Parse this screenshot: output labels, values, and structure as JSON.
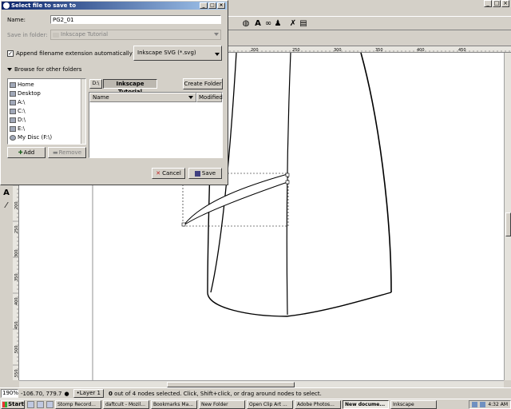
{
  "dialog": {
    "title": "Select file to save to",
    "name_label": "Name:",
    "name_value": "PG2_01",
    "save_in_label": "Save in folder:",
    "save_in_value": "Inkscape Tutorial",
    "append_label": "Append filename extension automatically",
    "append_checked": true,
    "file_type": "Inkscape SVG (*.svg)",
    "browse_label": "Browse for other folders",
    "places": [
      {
        "label": "Home",
        "icon": "home-icon"
      },
      {
        "label": "Desktop",
        "icon": "desktop-icon"
      },
      {
        "label": "A:\\",
        "icon": "floppy-icon"
      },
      {
        "label": "C:\\",
        "icon": "drive-icon"
      },
      {
        "label": "D:\\",
        "icon": "drive-icon"
      },
      {
        "label": "E:\\",
        "icon": "drive-icon"
      },
      {
        "label": "My Disc (F:\\)",
        "icon": "cd-icon"
      }
    ],
    "path_buttons": [
      "D:\\",
      "Inkscape Tutorial"
    ],
    "create_folder_label": "Create Folder",
    "columns": {
      "name": "Name",
      "modified": "Modified"
    },
    "add_label": "Add",
    "remove_label": "Remove",
    "cancel_label": "Cancel",
    "save_label": "Save"
  },
  "inkscape": {
    "ruler_marks": [
      "200",
      "250",
      "300",
      "350",
      "400",
      "450"
    ],
    "vruler_marks": [
      "200",
      "250",
      "300",
      "350",
      "400",
      "450",
      "500",
      "550"
    ]
  },
  "status": {
    "zoom": "190%",
    "coords": "-106.70, 779.7",
    "layer": "•Layer 1",
    "message_count": "0",
    "message": "out of 4 nodes selected. Click, Shift+click, or drag around nodes to select."
  },
  "taskbar": {
    "start": "Start",
    "tasks": [
      {
        "label": "Stomp Record...",
        "active": false
      },
      {
        "label": "daftcult - Mozil...",
        "active": false
      },
      {
        "label": "Bookmarks Ma...",
        "active": false
      },
      {
        "label": "New Folder",
        "active": false
      },
      {
        "label": "Open Clip Art ...",
        "active": false
      },
      {
        "label": "Adobe Photos...",
        "active": false
      },
      {
        "label": "New docume...",
        "active": true
      },
      {
        "label": "Inkscape",
        "active": false
      }
    ],
    "clock": "4:32 AM"
  },
  "colors": {
    "title_active": "#0a246a",
    "title_gradient_end": "#a6caf0",
    "face": "#d4d0c8"
  }
}
